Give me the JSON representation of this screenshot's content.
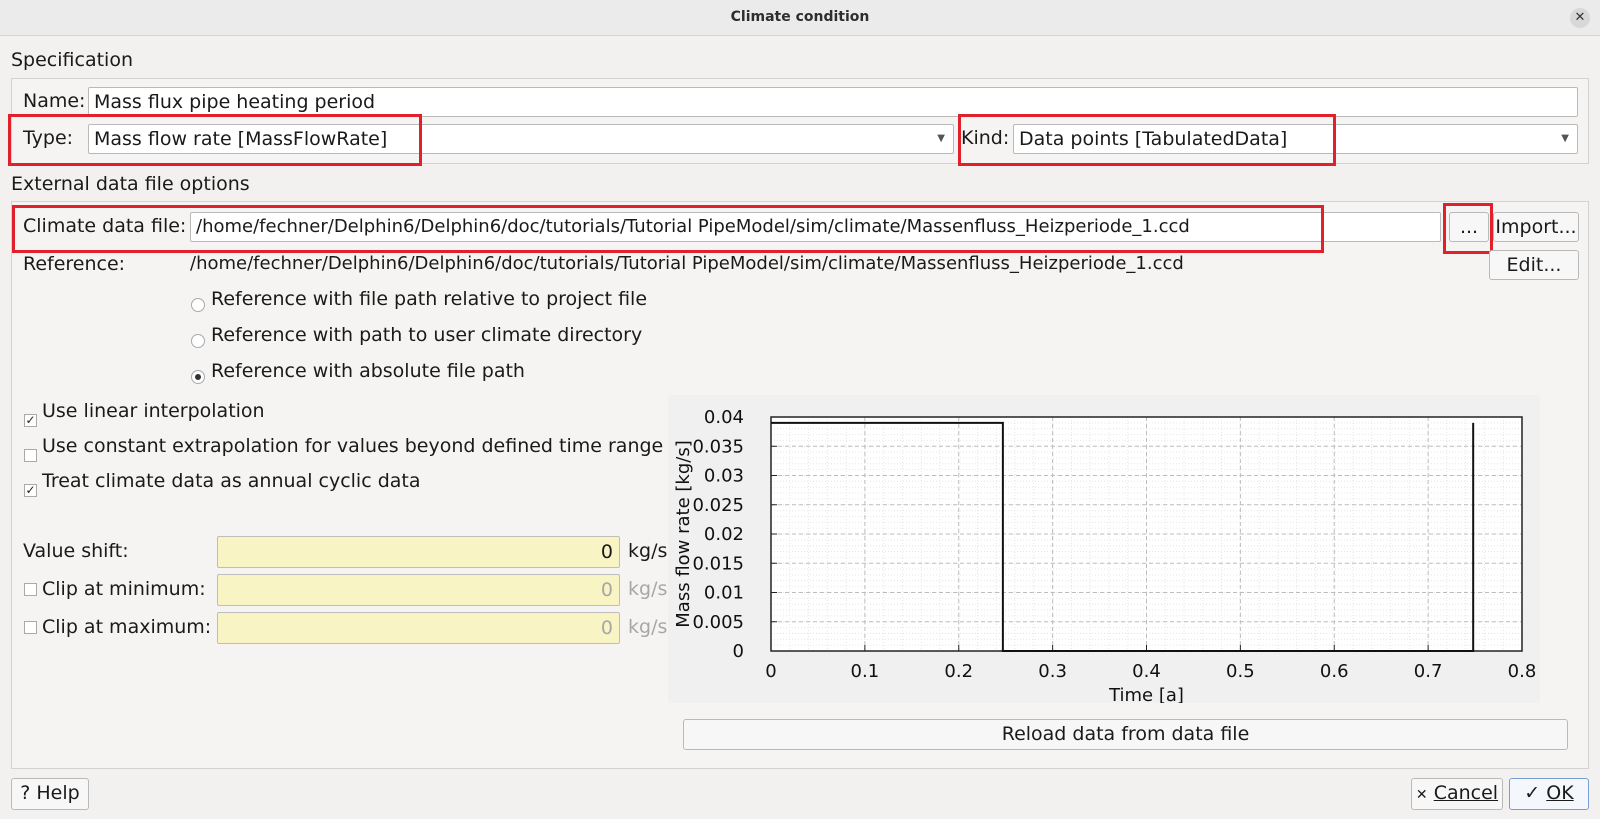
{
  "window": {
    "title": "Climate condition",
    "close_icon": "close-icon"
  },
  "specification": {
    "label": "Specification",
    "name_label": "Name:",
    "name_value": "Mass flux pipe heating period",
    "type_label": "Type:",
    "type_value": "Mass flow rate [MassFlowRate]",
    "kind_label": "Kind:",
    "kind_value": "Data points [TabulatedData]"
  },
  "external": {
    "label": "External data file options",
    "file_label": "Climate data file:",
    "file_value": "/home/fechner/Delphin6/Delphin6/doc/tutorials/Tutorial PipeModel/sim/climate/Massenfluss_Heizperiode_1.ccd",
    "browse_label": "...",
    "import_label": "Import...",
    "reference_label": "Reference:",
    "reference_value": "/home/fechner/Delphin6/Delphin6/doc/tutorials/Tutorial PipeModel/sim/climate/Massenfluss_Heizperiode_1.ccd",
    "edit_label": "Edit...",
    "radio_relative": "Reference with file path relative to project file",
    "radio_user_dir": "Reference with path to user climate directory",
    "radio_absolute": "Reference with absolute file path",
    "radio_selected": "absolute"
  },
  "options": {
    "linear_interp": "Use linear interpolation",
    "linear_interp_checked": true,
    "const_extrap": "Use constant extrapolation for values beyond defined time range",
    "const_extrap_checked": false,
    "annual_cyclic": "Treat climate data as annual cyclic data",
    "annual_cyclic_checked": true
  },
  "values": {
    "shift_label": "Value shift:",
    "shift_value": "0",
    "shift_unit": "kg/s",
    "clip_min_label": "Clip at minimum:",
    "clip_min_value": "0",
    "clip_min_unit": "kg/s",
    "clip_max_label": "Clip at maximum:",
    "clip_max_value": "0",
    "clip_max_unit": "kg/s"
  },
  "reload_label": "Reload data from data file",
  "footer": {
    "help_label": "? Help",
    "cancel_label": "Cancel",
    "ok_label": "OK"
  },
  "chart_data": {
    "type": "line",
    "xlabel": "Time [a]",
    "ylabel": "Mass flow rate [kg/s]",
    "xlim": [
      0,
      0.8
    ],
    "ylim": [
      0,
      0.04
    ],
    "xticks": [
      0,
      0.1,
      0.2,
      0.3,
      0.4,
      0.5,
      0.6,
      0.7,
      0.8
    ],
    "xtick_labels": [
      "0",
      "0.1",
      "0.2",
      "0.3",
      "0.4",
      "0.5",
      "0.6",
      "0.7",
      "0.8"
    ],
    "yticks": [
      0,
      0.005,
      0.01,
      0.015,
      0.02,
      0.025,
      0.03,
      0.035,
      0.04
    ],
    "ytick_labels": [
      "0",
      "0.005",
      "0.01",
      "0.015",
      "0.02",
      "0.025",
      "0.03",
      "0.035",
      "0.04"
    ],
    "grid": true,
    "series": [
      {
        "x": [
          0,
          0.247,
          0.247,
          0.748,
          0.748
        ],
        "y": [
          0.039,
          0.039,
          0,
          0,
          0.039
        ]
      }
    ]
  }
}
